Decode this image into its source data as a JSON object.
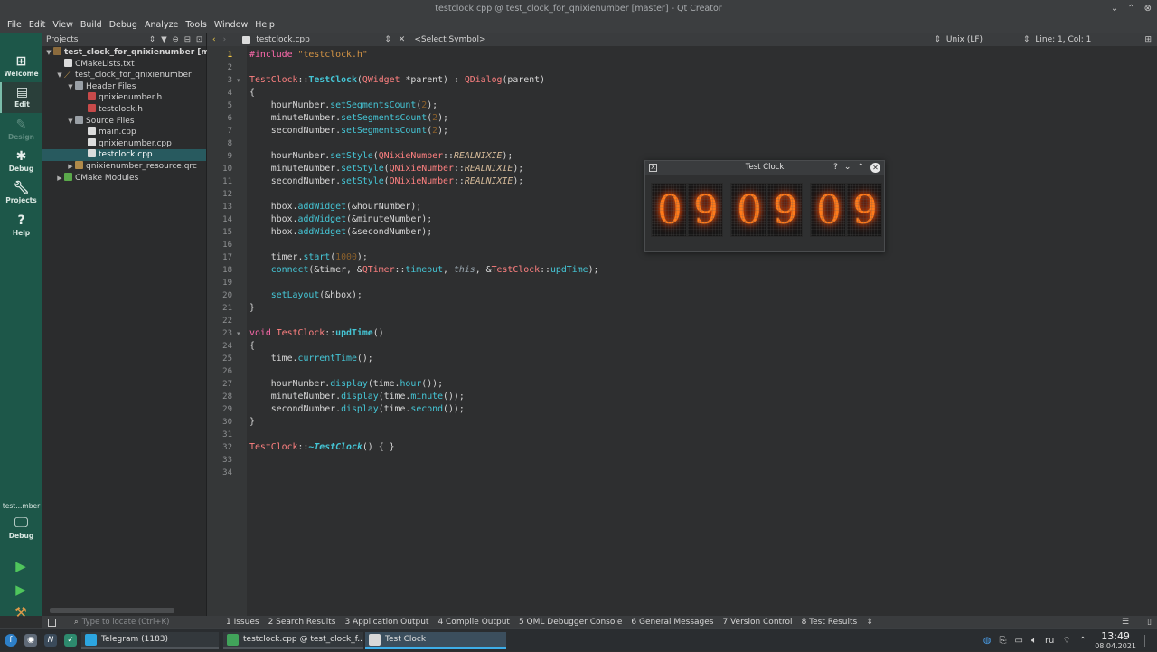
{
  "window": {
    "title": "testclock.cpp @ test_clock_for_qnixienumber [master] - Qt Creator",
    "btn_down": "⌄",
    "btn_up": "⌃",
    "btn_close": "⊗"
  },
  "menu": [
    "File",
    "Edit",
    "View",
    "Build",
    "Debug",
    "Analyze",
    "Tools",
    "Window",
    "Help"
  ],
  "modes": {
    "welcome": "Welcome",
    "edit": "Edit",
    "design": "Design",
    "debug": "Debug",
    "projects": "Projects",
    "help": "Help",
    "kit_name": "test...mber",
    "kit_mode": "Debug"
  },
  "projects": {
    "selector": "Projects",
    "items": [
      {
        "label": "test_clock_for_qnixienumber [m"
      },
      {
        "label": "CMakeLists.txt"
      },
      {
        "label": "test_clock_for_qnixienumber"
      },
      {
        "label": "Header Files"
      },
      {
        "label": "qnixienumber.h"
      },
      {
        "label": "testclock.h"
      },
      {
        "label": "Source Files"
      },
      {
        "label": "main.cpp"
      },
      {
        "label": "qnixienumber.cpp"
      },
      {
        "label": "testclock.cpp"
      },
      {
        "label": "qnixienumber_resource.qrc"
      },
      {
        "label": "CMake Modules"
      }
    ]
  },
  "editor_header": {
    "file": "testclock.cpp",
    "symbol": "<Select Symbol>",
    "line_ending": "Unix (LF)",
    "position": "Line: 1, Col: 1"
  },
  "dialog": {
    "title": "Test Clock",
    "help_btn": "?",
    "min_btn": "⌄",
    "max_btn": "⌃",
    "close_btn": "✕",
    "digits": [
      "0",
      "9",
      "0",
      "9",
      "0",
      "9"
    ]
  },
  "output_bar": {
    "locator_placeholder": "Type to locate (Ctrl+K)",
    "tabs": [
      "1  Issues",
      "2  Search Results",
      "3  Application Output",
      "4  Compile Output",
      "5  QML Debugger Console",
      "6  General Messages",
      "7  Version Control",
      "8  Test Results"
    ]
  },
  "taskbar": {
    "tasks": [
      {
        "label": "Telegram (1183)"
      },
      {
        "label": "testclock.cpp @ test_clock_f..."
      },
      {
        "label": "Test Clock"
      }
    ],
    "lang": "ru",
    "time": "13:49",
    "date": "08.04.2021"
  },
  "colors": {
    "accent": "#1d5749",
    "selection": "#285a5f",
    "nixie": "#ff7a1a"
  }
}
